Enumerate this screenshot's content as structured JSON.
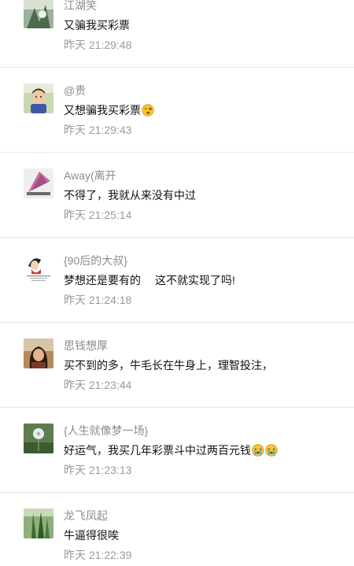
{
  "comments": [
    {
      "nickname": "江湖笑",
      "content": "又骗我买彩票",
      "time": "昨天 21:29:48",
      "avatar_icon": "green-plant-photo-icon"
    },
    {
      "nickname": "@贵",
      "content": "又想骗我买彩票",
      "time": "昨天 21:29:43",
      "avatar_icon": "child-photo-icon",
      "emoji": "dizzy-face-emoji-icon"
    },
    {
      "nickname": "Away(离开",
      "content": "不得了，我就从来没有中过",
      "time": "昨天 21:25:14",
      "avatar_icon": "pink-umbrella-photo-icon"
    },
    {
      "nickname": "{90后的大叔}",
      "content_part1": "梦想还是要有的",
      "content_part2": "这不就实现了吗!",
      "time": "昨天 21:24:18",
      "avatar_icon": "cartoon-person-icon"
    },
    {
      "nickname": "思钱想厚",
      "content": "买不到的多，牛毛长在牛身上，理智投注，",
      "time": "昨天 21:23:44",
      "avatar_icon": "woman-photo-icon"
    },
    {
      "nickname": "{人生就像梦一场}",
      "content": "好运气，我买几年彩票斗中过两百元钱",
      "time": "昨天 21:23:13",
      "avatar_icon": "dandelion-photo-icon",
      "emoji": "crying-face-emoji-icon"
    },
    {
      "nickname": "龙飞凤起",
      "content": "牛逼得很唉",
      "time": "昨天 21:22:39",
      "avatar_icon": "cactus-photo-icon"
    }
  ]
}
